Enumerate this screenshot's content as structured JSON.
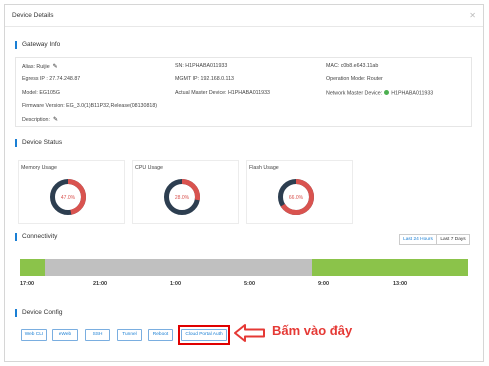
{
  "dialog": {
    "title": "Device Details",
    "close_icon": "close-icon"
  },
  "gateway_info": {
    "section_title": "Gateway Info",
    "alias": "Alias:  Ruijie",
    "sn": "SN:  H1PHABA011933",
    "mac": "MAC:  c0b8.e643.11ab",
    "egress_ip": "Egress IP :  27.74.248.87",
    "mgmt_ip": "MGMT IP:  192.168.0.113",
    "operation_mode": "Operation Mode:  Router",
    "model": "Model:  EG105G",
    "actual_master": "Actual Master Device:  H1PHABA011933",
    "network_master_label": "Network Master Device:",
    "network_master_value": "H1PHABA011933",
    "firmware": "Firmware Version:  EG_3.0(1)B11P32,Release(08130818)",
    "description": "Description:"
  },
  "device_status": {
    "section_title": "Device Status",
    "memory": {
      "label": "Memory Usage",
      "value_text": "47.0%",
      "value": 47.0
    },
    "cpu": {
      "label": "CPU Usage",
      "value_text": "28.0%",
      "value": 28.0
    },
    "flash": {
      "label": "Flash Usage",
      "value_text": "66.0%",
      "value": 66.0
    },
    "colors": {
      "used": "#d9534f",
      "free": "#2d3e50"
    }
  },
  "connectivity": {
    "section_title": "Connectivity",
    "range_buttons": [
      "Last 24 Hours",
      "Last 7 Days"
    ],
    "active_range": "Last 24 Hours",
    "ticks": [
      "17:00",
      "21:00",
      "1:00",
      "5:00",
      "9:00",
      "13:00"
    ],
    "colors": {
      "online": "#8bc34a",
      "offline": "#c0c0c0"
    }
  },
  "device_config": {
    "section_title": "Device Config",
    "buttons": [
      "Web CLI",
      "eWeb",
      "SSH",
      "Tunnel",
      "Reboot",
      "Cloud Portal Auth"
    ]
  },
  "annotation": {
    "text": "Bấm vào đây",
    "arrow_icon": "left-arrow-icon"
  }
}
